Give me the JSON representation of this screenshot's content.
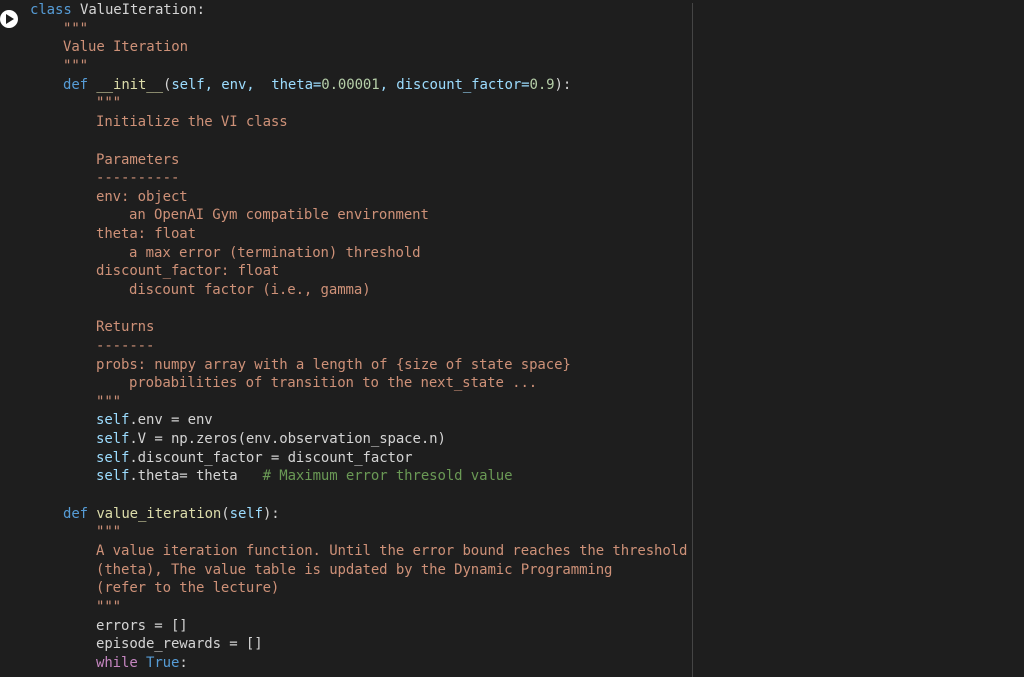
{
  "cell": {
    "run_icon": "play-icon"
  },
  "code": {
    "l01": {
      "kw": "class",
      "name": " ValueIteration",
      "rest": ":"
    },
    "l02": "\"\"\"",
    "l03": "Value Iteration",
    "l04": "\"\"\"",
    "l05": {
      "kw": "def",
      "name": " __init__",
      "p1": "(",
      "self": "self",
      "p2": ", env,  theta=",
      "n1": "0.00001",
      "p3": ", discount_factor=",
      "n2": "0.9",
      "p4": "):"
    },
    "l06": "\"\"\"",
    "l07": "Initialize the VI class",
    "l09": "Parameters",
    "l10": "----------",
    "l11": "env: object",
    "l12": "an OpenAI Gym compatible environment",
    "l13": "theta: float",
    "l14": "a max error (termination) threshold",
    "l15": "discount_factor: float",
    "l16": "discount factor (i.e., gamma)",
    "l18": "Returns",
    "l19": "-------",
    "l20": "probs: numpy array with a length of {size of state space}",
    "l21": "probabilities of transition to the next_state ...",
    "l22": "\"\"\"",
    "l23": {
      "self": "self",
      "rest": ".env = env"
    },
    "l24": {
      "self": "self",
      "rest": ".V = np.zeros(env.observation_space.n)"
    },
    "l25": {
      "self": "self",
      "rest": ".discount_factor = discount_factor"
    },
    "l26": {
      "self": "self",
      "rest": ".theta= theta   ",
      "comment": "# Maximum error thresold value"
    },
    "l28": {
      "kw": "def",
      "name": " value_iteration",
      "p1": "(",
      "self": "self",
      "p2": "):"
    },
    "l29": "\"\"\"",
    "l30": "A value iteration function. Until the error bound reaches the threshold",
    "l31": "(theta), The value table is updated by the Dynamic Programming",
    "l32": "(refer to the lecture)",
    "l33": "\"\"\"",
    "l34": "errors = []",
    "l35": "episode_rewards = []",
    "l36": {
      "kw": "while",
      "space": " ",
      "val": "True",
      "rest": ":"
    }
  }
}
